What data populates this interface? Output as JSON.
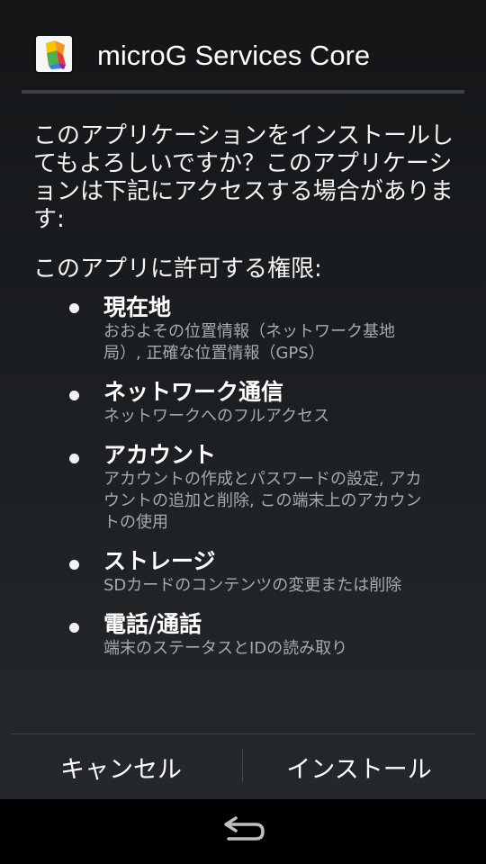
{
  "dialog": {
    "app_name": "microG Services Core",
    "icon": "puzzle-piece-icon",
    "prompt": "このアプリケーションをインストールしてもよろしいですか？このアプリケーションは下記にアクセスする場合があります:",
    "permissions_heading": "このアプリに許可する権限:",
    "permissions": [
      {
        "title": "現在地",
        "description": "おおよその位置情報（ネットワーク基地局）, 正確な位置情報（GPS）"
      },
      {
        "title": "ネットワーク通信",
        "description": "ネットワークへのフルアクセス"
      },
      {
        "title": "アカウント",
        "description": "アカウントの作成とパスワードの設定, アカウントの追加と削除, この端末上のアカウントの使用"
      },
      {
        "title": "ストレージ",
        "description": "SDカードのコンテンツの変更または削除"
      },
      {
        "title": "電話/通話",
        "description": "端末のステータスとIDの読み取り"
      }
    ],
    "buttons": {
      "cancel": "キャンセル",
      "install": "インストール"
    }
  },
  "navbar": {
    "back_icon": "back-arrow-icon"
  },
  "colors": {
    "dialog_background": "#1b1e21",
    "divider": "#3d4146",
    "secondary_text": "#a7aaad"
  }
}
